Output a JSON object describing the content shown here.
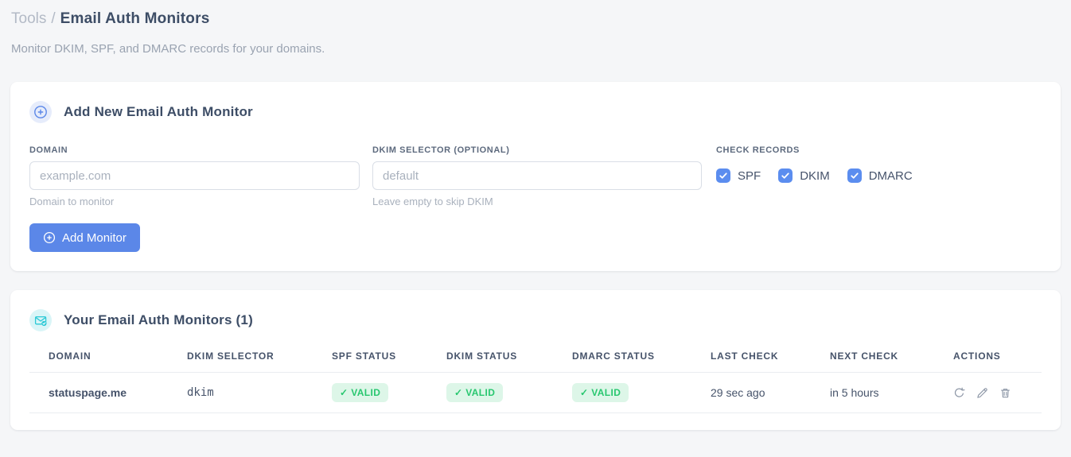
{
  "page": {
    "breadcrumb": {
      "section": "Tools",
      "separator": "/",
      "current": "Email Auth Monitors"
    },
    "subtitle": "Monitor DKIM, SPF, and DMARC records for your domains."
  },
  "add_monitor_card": {
    "title": "Add New Email Auth Monitor",
    "fields": {
      "domain": {
        "label": "DOMAIN",
        "placeholder": "example.com",
        "value": "",
        "hint": "Domain to monitor"
      },
      "dkim_selector": {
        "label": "DKIM SELECTOR (OPTIONAL)",
        "placeholder": "default",
        "value": "",
        "hint": "Leave empty to skip DKIM"
      }
    },
    "check_records": {
      "label": "CHECK RECORDS",
      "options": [
        {
          "label": "SPF",
          "checked": true
        },
        {
          "label": "DKIM",
          "checked": true
        },
        {
          "label": "DMARC",
          "checked": true
        }
      ]
    },
    "submit_label": "Add Monitor"
  },
  "monitors_card": {
    "title": "Your Email Auth Monitors (1)",
    "count": "1",
    "columns": [
      "DOMAIN",
      "DKIM SELECTOR",
      "SPF STATUS",
      "DKIM STATUS",
      "DMARC STATUS",
      "LAST CHECK",
      "NEXT CHECK",
      "ACTIONS"
    ],
    "rows": [
      {
        "domain": "statuspage.me",
        "dkim_selector": "dkim",
        "spf_status": "✓ VALID",
        "dkim_status": "✓ VALID",
        "dmarc_status": "✓ VALID",
        "last_check": "29 sec ago",
        "next_check": "in 5 hours"
      }
    ],
    "icons": [
      "refresh-icon",
      "pencil-icon",
      "trash-icon"
    ]
  },
  "colors": {
    "accent_blue": "#5b87e8",
    "checkbox_blue": "#5b8def",
    "badge_green_bg": "#ddf6e8",
    "badge_green_text": "#28c76f",
    "selector_pink": "#ea4c82",
    "icon_teal": "#2bc9d6"
  }
}
